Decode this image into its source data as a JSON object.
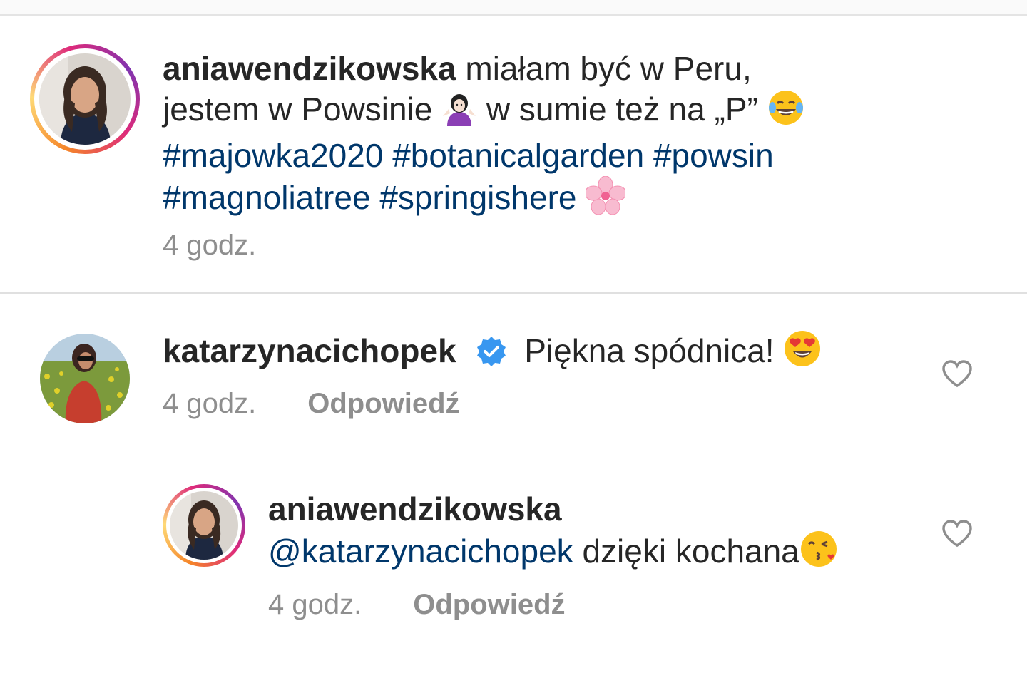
{
  "caption": {
    "username": "aniawendzikowska",
    "text1": "miałam być w Peru,",
    "text2": "jestem w Powsinie",
    "text3": "w sumie też na „P”",
    "hashtags_line1": [
      "#majowka2020",
      "#botanicalgarden",
      "#powsin"
    ],
    "hashtags_line2": [
      "#magnoliatree",
      "#springishere"
    ],
    "time": "4 godz."
  },
  "comment1": {
    "username": "katarzynacichopek",
    "text": "Piękna spódnica!",
    "time": "4 godz.",
    "reply_label": "Odpowiedź"
  },
  "reply1": {
    "username": "aniawendzikowska",
    "mention": "@katarzynacichopek",
    "text": "dzięki kochana",
    "time": "4 godz.",
    "reply_label": "Odpowiedź"
  },
  "colors": {
    "hashtag": "#00376b",
    "verified": "#3897f0",
    "meta": "#8e8e8e"
  },
  "icons": [
    "person-shrugging-emoji",
    "tears-of-joy-emoji",
    "cherry-blossom-emoji",
    "heart-eyes-emoji",
    "kiss-emoji",
    "verified-badge-icon",
    "heart-outline-icon"
  ]
}
